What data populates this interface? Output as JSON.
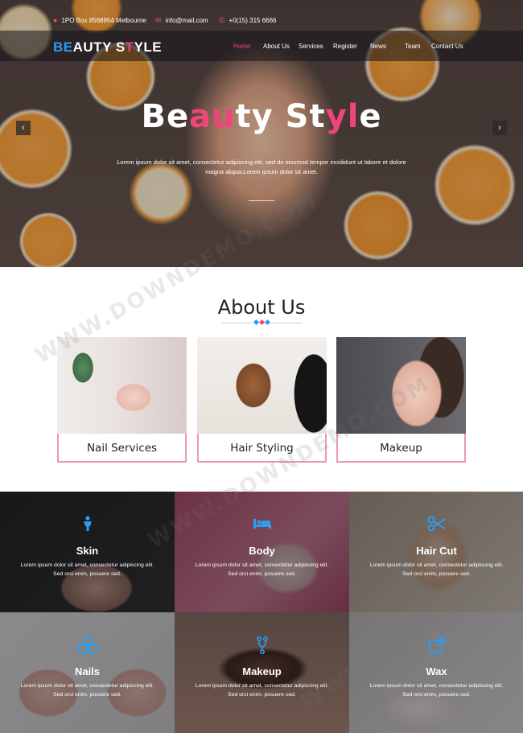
{
  "topbar": {
    "address": "1PO Box 8568954 Melbourne",
    "email": "info@mail.com",
    "phone": "+0(15) 315 6666"
  },
  "brand": {
    "logo_first": "B",
    "logo_second": "E",
    "logo_rest1": "AUTY ",
    "logo_s": "S",
    "logo_t": "T",
    "logo_rest2": "YLE"
  },
  "nav": [
    "Home",
    "About Us",
    "Services",
    "Register",
    "News",
    "Team",
    "Contact Us"
  ],
  "hero": {
    "title_a": "Be",
    "title_b": "au",
    "title_c": "ty St",
    "title_d": "y",
    "title_e": "l",
    "title_f": "e",
    "subtitle": "Lorem ipsum dolor sit amet, consectetur adipiscing elit, sed do eiusmod tempor incididunt ut labore et dolore magna aliqua.Lorem ipsum dolor sit amet.",
    "prev": "‹",
    "next": "›"
  },
  "about": {
    "title": "About Us",
    "cards": [
      "Nail Services",
      "Hair Styling",
      "Makeup"
    ]
  },
  "services": [
    {
      "title": "Skin",
      "desc": "Lorem ipsum dolor sit amet, consectetur adipiscing elit. Sed orci enim, posuere sed."
    },
    {
      "title": "Body",
      "desc": "Lorem ipsum dolor sit amet, consectetur adipiscing elit. Sed orci enim, posuere sed."
    },
    {
      "title": "Hair Cut",
      "desc": "Lorem ipsum dolor sit amet, consectetur adipiscing elit. Sed orci enim, posuere sed."
    },
    {
      "title": "Nails",
      "desc": "Lorem ipsum dolor sit amet, consectetur adipiscing elit. Sed orci enim, posuere sed."
    },
    {
      "title": "Makeup",
      "desc": "Lorem ipsum dolor sit amet, consectetur adipiscing elit. Sed orci enim, posuere sed."
    },
    {
      "title": "Wax",
      "desc": "Lorem ipsum dolor sit amet, consectetur adipiscing elit. Sed orci enim, posuere sed."
    }
  ],
  "watermark": "WWW.DOWNDEMO.COM",
  "colors": {
    "accent_pink": "#f0457a",
    "accent_blue": "#2b9cf0",
    "card_border": "#e897bd"
  }
}
